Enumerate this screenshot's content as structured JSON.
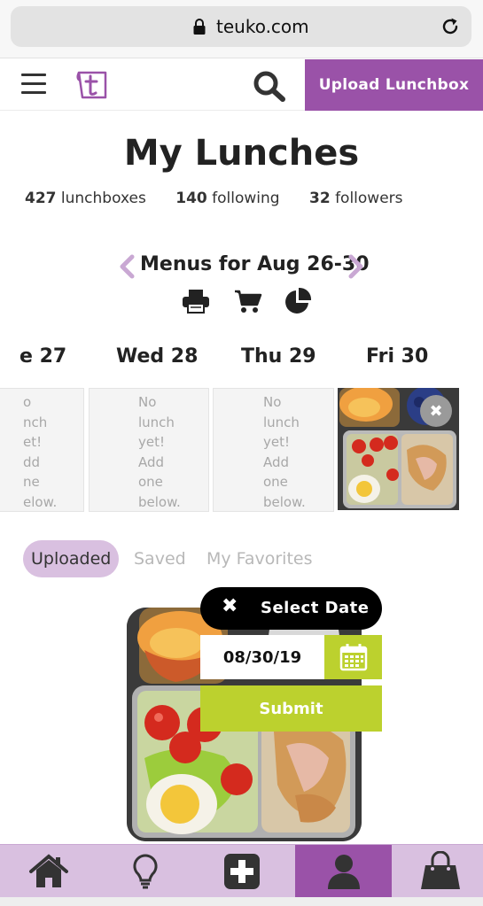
{
  "browser": {
    "url": "teuko.com"
  },
  "header": {
    "upload_label": "Upload Lunchbox"
  },
  "profile": {
    "title": "My Lunches",
    "stats": [
      {
        "value": "427",
        "label": "lunchboxes"
      },
      {
        "value": "140",
        "label": "following"
      },
      {
        "value": "32",
        "label": "followers"
      }
    ]
  },
  "week": {
    "label": "Menus for Aug 26-30"
  },
  "days": [
    {
      "label": "e 27",
      "empty_text": "o\nnch\net!\ndd\nne\nelow."
    },
    {
      "label": "Wed 28",
      "empty_text": "No\nlunch\nyet!\nAdd\none\nbelow."
    },
    {
      "label": "Thu 29",
      "empty_text": "No\nlunch\nyet!\nAdd\none\nbelow."
    },
    {
      "label": "Fri 30"
    }
  ],
  "tabs": [
    {
      "label": "Uploaded",
      "active": true
    },
    {
      "label": "Saved",
      "active": false
    },
    {
      "label": "My Favorites",
      "active": false
    }
  ],
  "date_picker": {
    "title": "Select Date",
    "date_value": "08/30/19",
    "submit_label": "Submit"
  },
  "colors": {
    "brand_purple": "#9a52a8",
    "light_purple": "#d9c0e0",
    "lime": "#bcd12e"
  }
}
